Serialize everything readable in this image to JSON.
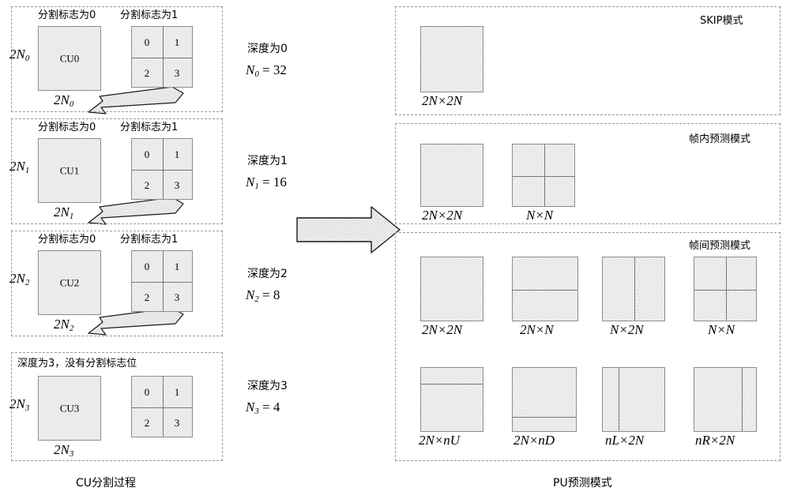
{
  "figure": {
    "left_caption": "CU分割过程",
    "right_caption": "PU预测模式"
  },
  "cu_partition": {
    "flag0_label": "分割标志为0",
    "flag1_label": "分割标志为1",
    "quad_cells": [
      "0",
      "1",
      "2",
      "3"
    ],
    "levels": [
      {
        "cu_label": "CU0",
        "height_label_base": "2N",
        "height_label_sub": "0",
        "width_label_base": "2N",
        "width_label_sub": "0",
        "flag0_label": "分割标志为0",
        "flag1_label": "分割标志为1",
        "has_flags": true,
        "note": ""
      },
      {
        "cu_label": "CU1",
        "height_label_base": "2N",
        "height_label_sub": "1",
        "width_label_base": "2N",
        "width_label_sub": "1",
        "flag0_label": "分割标志为0",
        "flag1_label": "分割标志为1",
        "has_flags": true,
        "note": ""
      },
      {
        "cu_label": "CU2",
        "height_label_base": "2N",
        "height_label_sub": "2",
        "width_label_base": "2N",
        "width_label_sub": "2",
        "flag0_label": "分割标志为0",
        "flag1_label": "分割标志为1",
        "has_flags": true,
        "note": ""
      },
      {
        "cu_label": "CU3",
        "height_label_base": "2N",
        "height_label_sub": "3",
        "width_label_base": "2N",
        "width_label_sub": "3",
        "flag0_label": "",
        "flag1_label": "",
        "has_flags": false,
        "note": "深度为3，没有分割标志位"
      }
    ]
  },
  "depth_annotations": [
    {
      "depth_text": "深度为0",
      "n_base": "N",
      "n_sub": "0",
      "n_value": "= 32"
    },
    {
      "depth_text": "深度为1",
      "n_base": "N",
      "n_sub": "1",
      "n_value": "= 16"
    },
    {
      "depth_text": "深度为2",
      "n_base": "N",
      "n_sub": "2",
      "n_value": "= 8"
    },
    {
      "depth_text": "深度为3",
      "n_base": "N",
      "n_sub": "3",
      "n_value": "= 4"
    }
  ],
  "pu_modes": {
    "skip": {
      "title": "SKIP模式",
      "items": [
        {
          "label": "2N×2N",
          "split": "none"
        }
      ]
    },
    "intra": {
      "title": "帧内预测模式",
      "items": [
        {
          "label": "2N×2N",
          "split": "none"
        },
        {
          "label": "N×N",
          "split": "quad"
        }
      ]
    },
    "inter": {
      "title": "帧间预测模式",
      "row1": [
        {
          "label": "2N×2N",
          "split": "none"
        },
        {
          "label": "2N×N",
          "split": "horizontal-half"
        },
        {
          "label": "N×2N",
          "split": "vertical-half"
        },
        {
          "label": "N×N",
          "split": "quad"
        }
      ],
      "row2": [
        {
          "label": "2N×nU",
          "split": "horizontal-upper-quarter"
        },
        {
          "label": "2N×nD",
          "split": "horizontal-lower-quarter"
        },
        {
          "label": "nL×2N",
          "split": "vertical-left-quarter"
        },
        {
          "label": "nR×2N",
          "split": "vertical-right-quarter"
        }
      ]
    }
  },
  "colors": {
    "block_fill": "#f2f2f2",
    "block_stipple": "#b9b9b9",
    "block_border": "#8c8c8c",
    "panel_border": "#9a9a9a",
    "arrow_fill": "#e0e0e0",
    "arrow_stroke": "#222222",
    "text": "#000000"
  }
}
